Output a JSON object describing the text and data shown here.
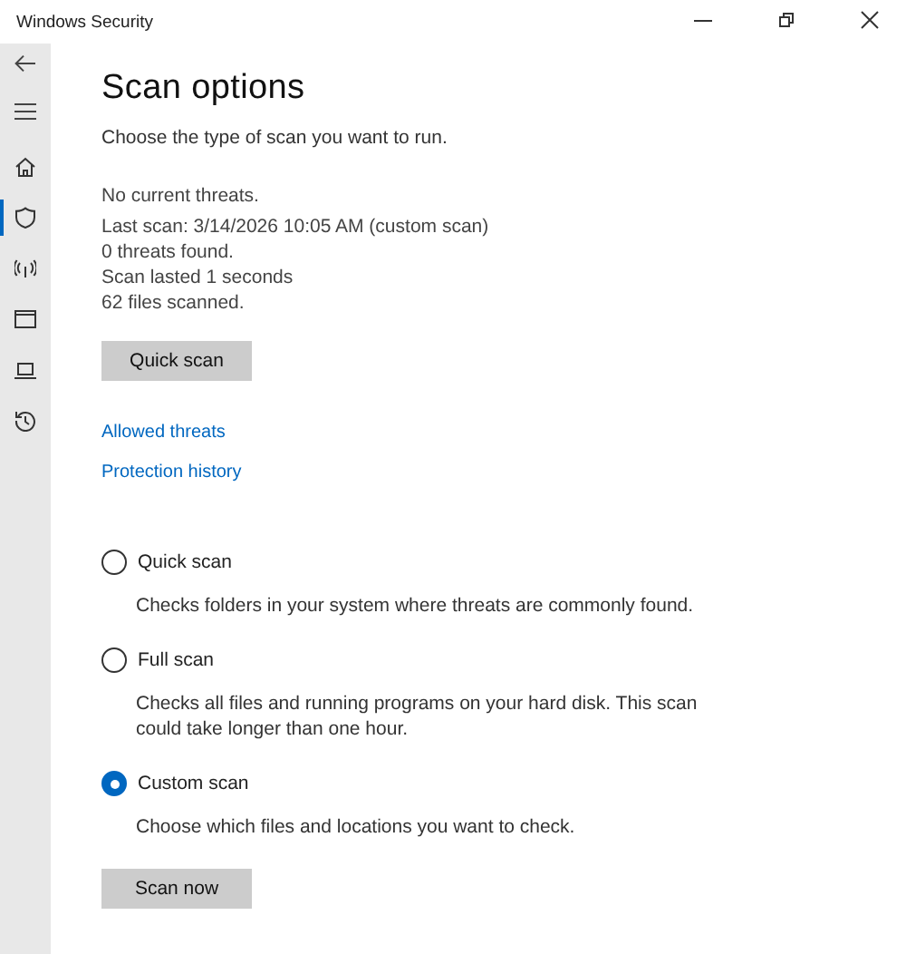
{
  "window": {
    "title": "Windows Security"
  },
  "sidebar": {
    "items": [
      {
        "kind": "home",
        "selected": false
      },
      {
        "kind": "shield",
        "selected": true
      },
      {
        "kind": "wireless",
        "selected": false
      },
      {
        "kind": "browser",
        "selected": false
      },
      {
        "kind": "laptop",
        "selected": false
      },
      {
        "kind": "history",
        "selected": false
      }
    ]
  },
  "page": {
    "title": "Scan options",
    "subtitle": "Choose the type of scan you want to run.",
    "status": [
      "No current threats.",
      "Last scan: 3/14/2026 10:05 AM (custom scan)",
      "0 threats found.",
      "Scan lasted 1 seconds",
      "62 files scanned."
    ],
    "quick_button": "Quick scan",
    "links": [
      "Allowed threats",
      "Protection history"
    ],
    "options": [
      {
        "label": "Quick scan",
        "description": "Checks folders in your system where threats are commonly found.",
        "selected": false
      },
      {
        "label": "Full scan",
        "description": "Checks all files and running programs on your hard disk. This scan could take longer than one hour.",
        "selected": false
      },
      {
        "label": "Custom scan",
        "description": "Choose which files and locations you want to check.",
        "selected": true
      }
    ],
    "scan_button": "Scan now"
  }
}
